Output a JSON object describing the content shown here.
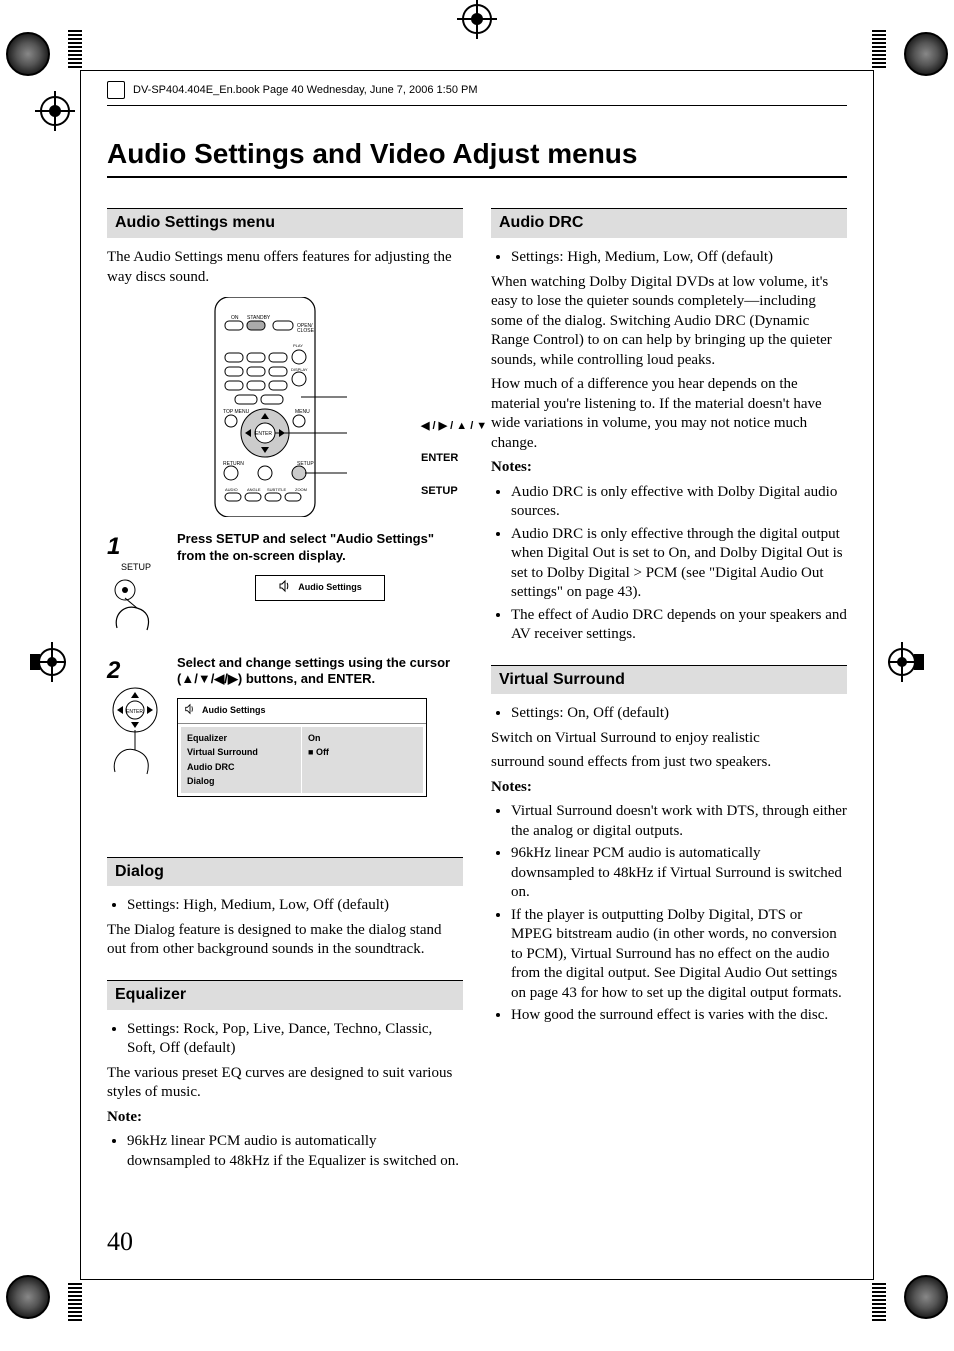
{
  "header": "DV-SP404.404E_En.book  Page 40  Wednesday, June 7, 2006  1:50 PM",
  "page_number": "40",
  "page_title": "Audio Settings and Video Adjust menus",
  "callouts": {
    "arrows": "◀ / ▶ / ▲ / ▼",
    "enter": "ENTER",
    "setup": "SETUP"
  },
  "left": {
    "s1_head": "Audio Settings menu",
    "s1_p1": "The Audio Settings menu offers features for adjusting the way discs sound.",
    "step1": {
      "num": "1",
      "setup_label": "SETUP",
      "text": "Press SETUP and select \"Audio Settings\" from the on-screen display.",
      "pill": "Audio Settings"
    },
    "step2": {
      "num": "2",
      "text_a": "Select and change settings using the cursor (",
      "text_b": "▲/▼/◀/▶",
      "text_c": ") buttons, and ENTER.",
      "menu_head": "Audio Settings",
      "rows": {
        "r1l": "Equalizer",
        "r1r": "On",
        "r2l": "Virtual Surround",
        "r2r_prefix": "■ ",
        "r2r": "Off",
        "r3l": "Audio DRC",
        "r4l": "Dialog"
      }
    },
    "dialog_head": "Dialog",
    "dialog_bullet": "Settings: High, Medium, Low, Off (default)",
    "dialog_p": "The Dialog feature is designed to make the dialog stand out from other background sounds in the soundtrack.",
    "eq_head": "Equalizer",
    "eq_bullet": "Settings: Rock, Pop, Live, Dance, Techno, Classic, Soft, Off (default)",
    "eq_p": "The various preset EQ curves are designed to suit various styles of music.",
    "eq_note_label": "Note:",
    "eq_note": "96kHz linear PCM audio is automatically downsampled to 48kHz if the Equalizer is switched on."
  },
  "right": {
    "drc_head": "Audio DRC",
    "drc_bullet": "Settings: High, Medium, Low, Off (default)",
    "drc_p1": "When watching Dolby Digital DVDs at low volume, it's easy to lose the quieter sounds completely—including some of the dialog. Switching Audio DRC (Dynamic Range Control) to on can help by bringing up the quieter sounds, while controlling loud peaks.",
    "drc_p2": "How much of a difference you hear depends on the material you're listening to. If the material doesn't have wide variations in volume, you may not notice much change.",
    "drc_notes_label": "Notes:",
    "drc_note1": "Audio DRC is only effective with Dolby Digital audio sources.",
    "drc_note2": "Audio DRC is only effective through the digital output when Digital Out is set to On, and Dolby Digital Out is set to Dolby Digital > PCM (see \"Digital Audio Out settings\" on page 43).",
    "drc_note3": "The effect of Audio DRC depends on your speakers and AV receiver settings.",
    "vs_head": "Virtual Surround",
    "vs_bullet": "Settings: On, Off (default)",
    "vs_p1": "Switch on Virtual Surround to enjoy realistic",
    "vs_p2": "surround sound effects from just two speakers.",
    "vs_notes_label": "Notes:",
    "vs_note1": "Virtual Surround doesn't work with DTS, through either the analog or digital outputs.",
    "vs_note2": "96kHz linear PCM audio is automatically downsampled to 48kHz if Virtual Surround is switched on.",
    "vs_note3": "If the player is outputting Dolby Digital, DTS or MPEG bitstream audio (in other words, no conversion to PCM), Virtual Surround has no effect on the audio from the digital output. See Digital Audio Out settings on page 43 for how to set up the digital output formats.",
    "vs_note4": "How good the surround effect is varies with the disc."
  }
}
